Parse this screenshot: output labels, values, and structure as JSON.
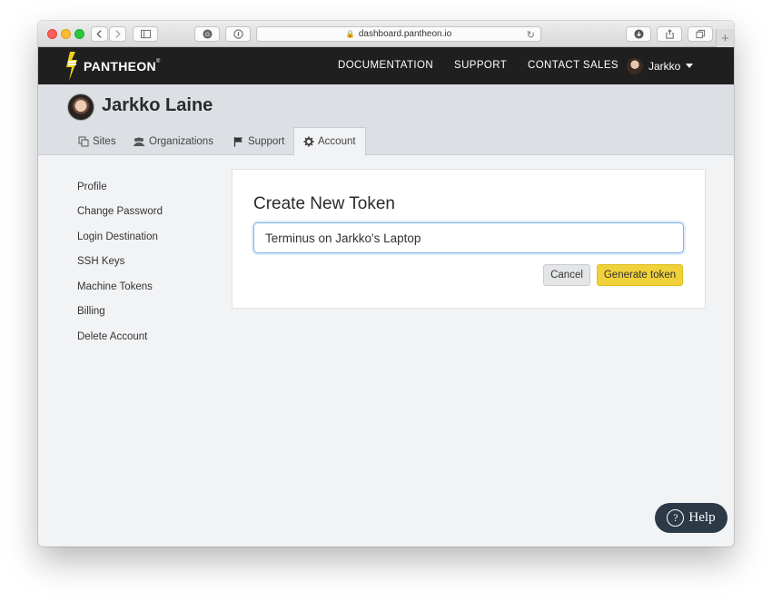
{
  "browser": {
    "url": "dashboard.pantheon.io"
  },
  "nav": {
    "brand": "PANTHEON",
    "brand_mark": "®",
    "links": [
      "DOCUMENTATION",
      "SUPPORT",
      "CONTACT SALES"
    ],
    "user": "Jarkko"
  },
  "profile": {
    "name": "Jarkko Laine",
    "tabs": [
      {
        "label": "Sites",
        "icon": "copy-icon"
      },
      {
        "label": "Organizations",
        "icon": "users-icon"
      },
      {
        "label": "Support",
        "icon": "flag-icon"
      },
      {
        "label": "Account",
        "icon": "gear-icon"
      }
    ],
    "active_tab": "Account"
  },
  "sidebar": {
    "items": [
      "Profile",
      "Change Password",
      "Login Destination",
      "SSH Keys",
      "Machine Tokens",
      "Billing",
      "Delete Account"
    ]
  },
  "token_form": {
    "title": "Create New Token",
    "value": "Terminus on Jarkko's Laptop",
    "cancel_label": "Cancel",
    "generate_label": "Generate token"
  },
  "help": {
    "label": "Help",
    "icon_glyph": "?"
  },
  "colors": {
    "nav_bg": "#1f1f1f",
    "accent_yellow": "#f1d13a",
    "focus_blue": "#7fb0e6",
    "help_bg": "#2c3a47"
  }
}
